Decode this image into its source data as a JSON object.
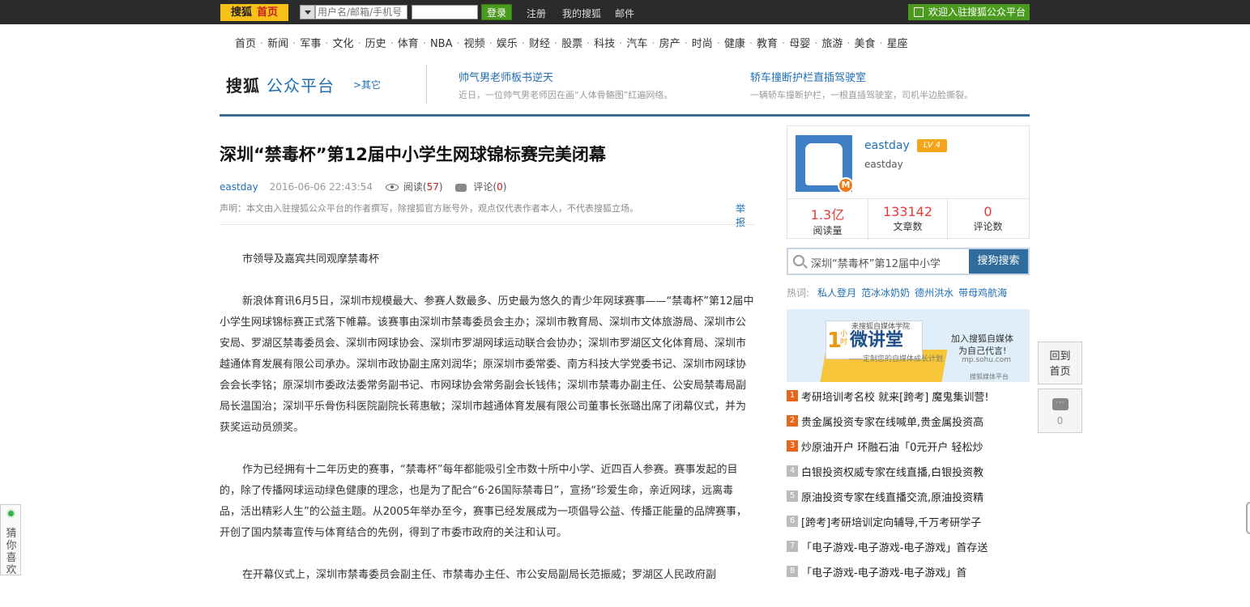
{
  "topbar": {
    "logo_brand": "搜狐",
    "logo_home": "首页",
    "username_placeholder": "用户名/邮箱/手机号",
    "login_button": "登录",
    "links": [
      "注册",
      "我的搜狐",
      "邮件"
    ],
    "welcome": "欢迎入驻搜狐公众平台"
  },
  "nav": {
    "items": [
      "首页",
      "新闻",
      "军事",
      "文化",
      "历史",
      "体育",
      "NBA",
      "视频",
      "娱乐",
      "财经",
      "股票",
      "科技",
      "汽车",
      "房产",
      "时尚",
      "健康",
      "教育",
      "母婴",
      "旅游",
      "美食",
      "星座"
    ]
  },
  "platform": {
    "brand": "搜狐",
    "brand_sub": "公众平台",
    "other": ">其它",
    "headlines": [
      {
        "title": "帅气男老师板书逆天",
        "summary": "近日，一位帅气男老师因在画“人体骨骼图”红遍网络。"
      },
      {
        "title": "轿车撞断护栏直插驾驶室",
        "summary": "一辆轿车撞断护栏，一根直插驾驶室，司机半边脸撕裂。"
      }
    ]
  },
  "article": {
    "title": "深圳“禁毒杯”第12届中小学生网球锦标赛完美闭幕",
    "author": "eastday",
    "time": "2016-06-06 22:43:54",
    "read_label": "阅读",
    "read_count": "57",
    "comment_label": "评论",
    "comment_count": "0",
    "notice": "声明：本文由入驻搜狐公众平台的作者撰写，除搜狐官方账号外，观点仅代表作者本人，不代表搜狐立场。",
    "report": "举报",
    "paragraphs": [
      "市领导及嘉宾共同观摩禁毒杯",
      "新浪体育讯6月5日，深圳市规模最大、参赛人数最多、历史最为悠久的青少年网球赛事——“禁毒杯”第12届中小学生网球锦标赛正式落下帷幕。该赛事由深圳市禁毒委员会主办；深圳市教育局、深圳市文体旅游局、深圳市公安局、罗湖区禁毒委员会、深圳市网球协会、深圳市罗湖网球运动联合会协办；深圳市罗湖区文化体育局、深圳市越通体育发展有限公司承办。深圳市政协副主席刘润华；原深圳市委常委、南方科技大学党委书记、深圳市网球协会会长李铭；原深圳市委政法委常务副书记、市网球协会常务副会长钱伟；深圳市禁毒办副主任、公安局禁毒局副局长温国治；深圳平乐骨伤科医院副院长蒋惠敏；深圳市越通体育发展有限公司董事长张璐出席了闭幕仪式，并为获奖运动员颁奖。",
      "作为已经拥有十二年历史的赛事，“禁毒杯”每年都能吸引全市数十所中小学、近四百人参赛。赛事发起的目的，除了传播网球运动绿色健康的理念，也是为了配合“6·26国际禁毒日”，宣扬“珍爱生命，亲近网球，远离毒品，活出精彩人生”的公益主题。从2005年举办至今，赛事已经发展成为一项倡导公益、传播正能量的品牌赛事，开创了国内禁毒宣传与体育结合的先例，得到了市委市政府的关注和认可。",
      "在开幕仪式上，深圳市禁毒委员会副主任、市禁毒办主任、市公安局副局长范振威；罗湖区人民政府副"
    ]
  },
  "sidebar": {
    "profile": {
      "avatar_badge": "M",
      "name": "eastday",
      "level": "LV 4",
      "desc": "eastday",
      "stats": [
        {
          "value": "1.3亿",
          "label": "阅读量"
        },
        {
          "value": "133142",
          "label": "文章数"
        },
        {
          "value": "0",
          "label": "评论数"
        }
      ]
    },
    "search": {
      "query": "深圳“禁毒杯”第12届中小学",
      "button": "搜狗搜索"
    },
    "hot": {
      "label": "热词:",
      "keywords": [
        "私人登月",
        "范冰冰奶奶",
        "德州洪水",
        "带母鸡航海"
      ]
    },
    "banner": {
      "num": "1",
      "unit": "小时",
      "title": "微讲堂",
      "school": "来搜狐自媒体学院",
      "tagline": "——定制您的自媒体成长计划",
      "right1": "加入搜狐自媒体",
      "right2": "为自己代言!",
      "url": "mp.sohu.com",
      "foot": "搜狐媒体平台"
    },
    "ads": [
      {
        "n": "1",
        "text": "考研培训考名校 就来[跨考] 魔鬼集训营!"
      },
      {
        "n": "2",
        "text": "贵金属投资专家在线喊单,贵金属投资高"
      },
      {
        "n": "3",
        "text": "炒原油开户 环融石油「0元开户 轻松炒"
      },
      {
        "n": "4",
        "text": "白银投资权威专家在线直播,白银投资教"
      },
      {
        "n": "5",
        "text": "原油投资专家在线直播交流,原油投资精"
      },
      {
        "n": "6",
        "text": "[跨考]考研培训定向辅导,千万考研学子"
      },
      {
        "n": "7",
        "text": "「电子游戏-电子游戏-电子游戏」首存送"
      },
      {
        "n": "8",
        "text": "「电子游戏-电子游戏-电子游戏」首"
      }
    ]
  },
  "floats": {
    "back_top": "回到首页",
    "comment_count": "0",
    "comment_icon_text": "···",
    "guess": "猜你喜欢"
  }
}
